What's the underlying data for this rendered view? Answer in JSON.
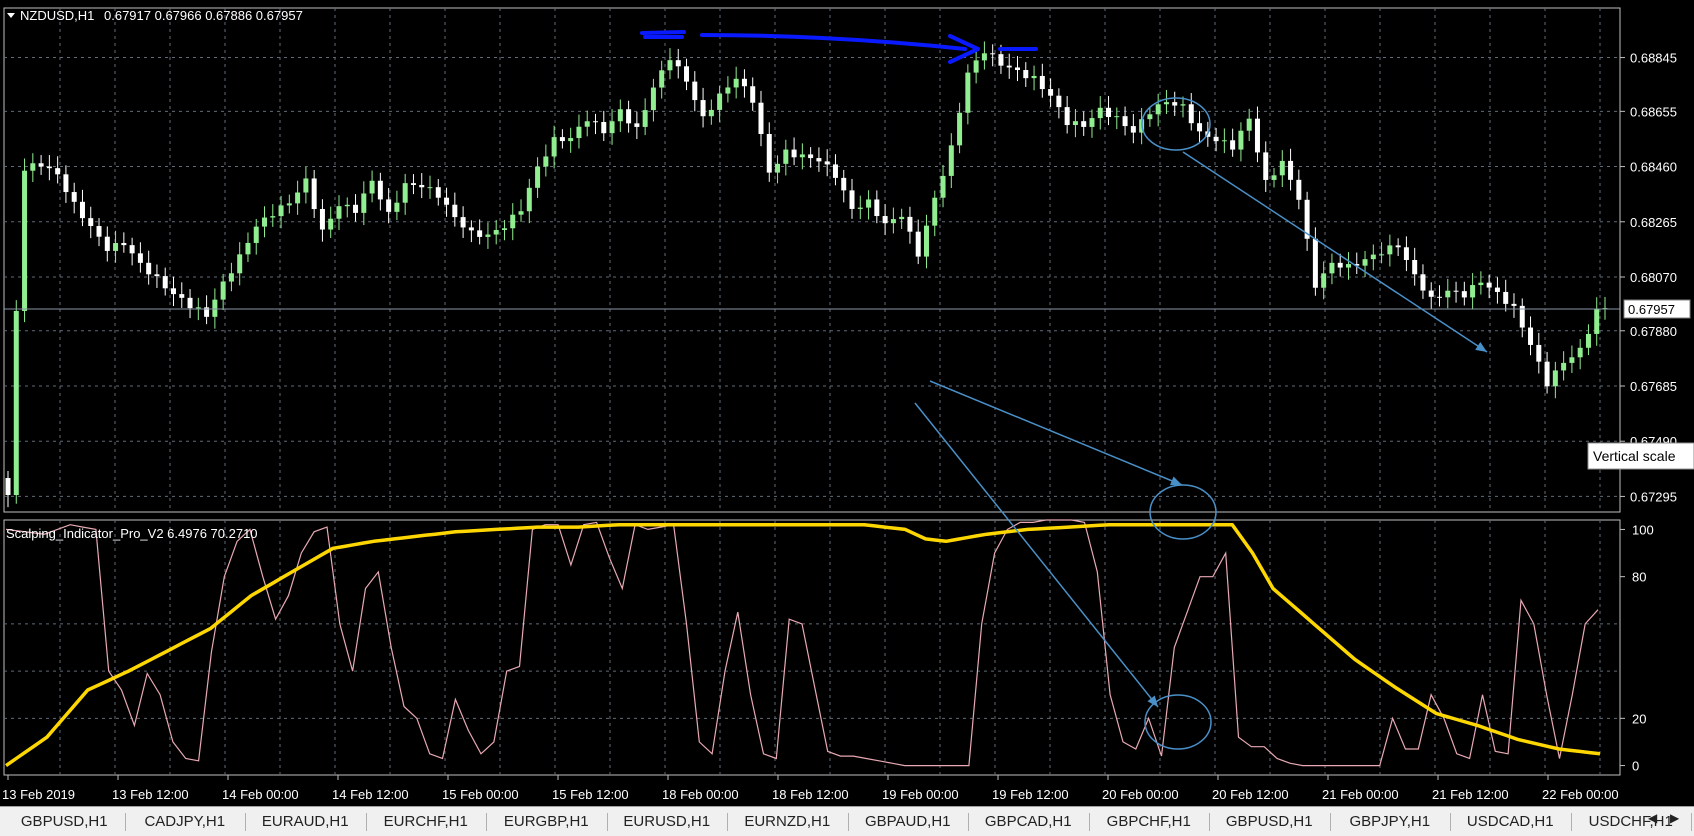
{
  "chart_data": {
    "type": "candlestick",
    "symbol_header": "NZDUSD,H1",
    "ohlc_header": "0.67917 0.67966 0.67886 0.67957",
    "current_price_label": "0.67957",
    "current_price": 0.67957,
    "price_ylim": [
      0.6724,
      0.6902
    ],
    "price_ticks": [
      "0.68845",
      "0.68655",
      "0.68460",
      "0.68265",
      "0.68070",
      "0.67880",
      "0.67685",
      "0.67490",
      "0.67295"
    ],
    "price_tick_values": [
      0.68845,
      0.68655,
      0.6846,
      0.68265,
      0.6807,
      0.6788,
      0.67685,
      0.6749,
      0.67295
    ],
    "x_ticks": [
      "13 Feb 2019",
      "13 Feb 12:00",
      "14 Feb 00:00",
      "14 Feb 12:00",
      "15 Feb 00:00",
      "15 Feb 12:00",
      "18 Feb 00:00",
      "18 Feb 12:00",
      "19 Feb 00:00",
      "19 Feb 12:00",
      "20 Feb 00:00",
      "20 Feb 12:00",
      "21 Feb 00:00",
      "21 Feb 12:00",
      "22 Feb 00:00"
    ],
    "indicator_header": "Scalping_Indicator_Pro_V2 6.4976 70.2710",
    "indicator_ylim": [
      -4,
      104
    ],
    "indicator_ticks": [
      "100",
      "80",
      "20",
      "0"
    ],
    "indicator_tick_values": [
      100,
      80,
      20,
      0
    ],
    "close_anchors": [
      [
        0,
        0.673
      ],
      [
        1,
        0.6795
      ],
      [
        2,
        0.6845
      ],
      [
        4,
        0.6846
      ],
      [
        6,
        0.6842
      ],
      [
        8,
        0.6832
      ],
      [
        10,
        0.6825
      ],
      [
        12,
        0.6818
      ],
      [
        14,
        0.682
      ],
      [
        16,
        0.6812
      ],
      [
        18,
        0.6806
      ],
      [
        20,
        0.68
      ],
      [
        22,
        0.6796
      ],
      [
        24,
        0.6793
      ],
      [
        26,
        0.6805
      ],
      [
        28,
        0.6815
      ],
      [
        30,
        0.6826
      ],
      [
        32,
        0.683
      ],
      [
        34,
        0.6833
      ],
      [
        36,
        0.684
      ],
      [
        38,
        0.6822
      ],
      [
        40,
        0.6832
      ],
      [
        42,
        0.6831
      ],
      [
        44,
        0.6842
      ],
      [
        46,
        0.683
      ],
      [
        48,
        0.684
      ],
      [
        50,
        0.6839
      ],
      [
        52,
        0.6835
      ],
      [
        54,
        0.6827
      ],
      [
        56,
        0.6822
      ],
      [
        58,
        0.6822
      ],
      [
        60,
        0.6826
      ],
      [
        62,
        0.6832
      ],
      [
        64,
        0.6846
      ],
      [
        66,
        0.6855
      ],
      [
        68,
        0.6855
      ],
      [
        70,
        0.6862
      ],
      [
        72,
        0.6858
      ],
      [
        74,
        0.6866
      ],
      [
        76,
        0.686
      ],
      [
        78,
        0.6875
      ],
      [
        80,
        0.6885
      ],
      [
        82,
        0.6876
      ],
      [
        84,
        0.6862
      ],
      [
        86,
        0.687
      ],
      [
        88,
        0.6877
      ],
      [
        90,
        0.687
      ],
      [
        92,
        0.6845
      ],
      [
        94,
        0.6852
      ],
      [
        96,
        0.685
      ],
      [
        98,
        0.6848
      ],
      [
        100,
        0.6842
      ],
      [
        102,
        0.683
      ],
      [
        104,
        0.6833
      ],
      [
        106,
        0.6826
      ],
      [
        108,
        0.683
      ],
      [
        110,
        0.6816
      ],
      [
        112,
        0.6835
      ],
      [
        114,
        0.6852
      ],
      [
        116,
        0.6878
      ],
      [
        118,
        0.6886
      ],
      [
        120,
        0.6882
      ],
      [
        122,
        0.688
      ],
      [
        124,
        0.6878
      ],
      [
        126,
        0.6872
      ],
      [
        128,
        0.6862
      ],
      [
        130,
        0.686
      ],
      [
        132,
        0.6865
      ],
      [
        134,
        0.6862
      ],
      [
        136,
        0.6858
      ],
      [
        138,
        0.6866
      ],
      [
        140,
        0.687
      ],
      [
        142,
        0.6868
      ],
      [
        144,
        0.6858
      ],
      [
        146,
        0.6855
      ],
      [
        148,
        0.6852
      ],
      [
        150,
        0.6862
      ],
      [
        152,
        0.684
      ],
      [
        154,
        0.6848
      ],
      [
        156,
        0.6836
      ],
      [
        158,
        0.6805
      ],
      [
        160,
        0.6812
      ],
      [
        162,
        0.681
      ],
      [
        164,
        0.6812
      ],
      [
        166,
        0.6815
      ],
      [
        168,
        0.6818
      ],
      [
        170,
        0.6808
      ],
      [
        172,
        0.68
      ],
      [
        174,
        0.6803
      ],
      [
        176,
        0.6801
      ],
      [
        178,
        0.6805
      ],
      [
        180,
        0.68
      ],
      [
        182,
        0.6795
      ],
      [
        184,
        0.6783
      ],
      [
        186,
        0.677
      ],
      [
        188,
        0.6778
      ],
      [
        190,
        0.6782
      ],
      [
        192,
        0.6795
      ],
      [
        193,
        0.6796
      ]
    ],
    "oscillator_anchors": [
      [
        0,
        100
      ],
      [
        3,
        98
      ],
      [
        5,
        102
      ],
      [
        7,
        100
      ],
      [
        8,
        40
      ],
      [
        9,
        32
      ],
      [
        10,
        17
      ],
      [
        11,
        39
      ],
      [
        12,
        30
      ],
      [
        13,
        10
      ],
      [
        14,
        3
      ],
      [
        15,
        2
      ],
      [
        16,
        48
      ],
      [
        17,
        80
      ],
      [
        18,
        95
      ],
      [
        19,
        100
      ],
      [
        20,
        80
      ],
      [
        21,
        62
      ],
      [
        22,
        72
      ],
      [
        23,
        90
      ],
      [
        24,
        99
      ],
      [
        25,
        101
      ],
      [
        26,
        60
      ],
      [
        27,
        40
      ],
      [
        28,
        75
      ],
      [
        29,
        82
      ],
      [
        30,
        50
      ],
      [
        31,
        25
      ],
      [
        32,
        20
      ],
      [
        33,
        5
      ],
      [
        34,
        3
      ],
      [
        35,
        28
      ],
      [
        36,
        15
      ],
      [
        37,
        5
      ],
      [
        38,
        10
      ],
      [
        39,
        40
      ],
      [
        40,
        42
      ],
      [
        41,
        100
      ],
      [
        42,
        102
      ],
      [
        43,
        102
      ],
      [
        44,
        85
      ],
      [
        45,
        102
      ],
      [
        46,
        103
      ],
      [
        47,
        88
      ],
      [
        48,
        75
      ],
      [
        49,
        102
      ],
      [
        50,
        100
      ],
      [
        51,
        101
      ],
      [
        52,
        102
      ],
      [
        53,
        60
      ],
      [
        54,
        10
      ],
      [
        55,
        5
      ],
      [
        56,
        40
      ],
      [
        57,
        65
      ],
      [
        58,
        30
      ],
      [
        59,
        5
      ],
      [
        60,
        3
      ],
      [
        61,
        62
      ],
      [
        62,
        60
      ],
      [
        63,
        33
      ],
      [
        64,
        6
      ],
      [
        65,
        4
      ],
      [
        66,
        4
      ],
      [
        67,
        3
      ],
      [
        68,
        2
      ],
      [
        69,
        1
      ],
      [
        70,
        0
      ],
      [
        71,
        0
      ],
      [
        72,
        0
      ],
      [
        73,
        0
      ],
      [
        74,
        0
      ],
      [
        75,
        0
      ],
      [
        76,
        60
      ],
      [
        77,
        90
      ],
      [
        78,
        100
      ],
      [
        79,
        103
      ],
      [
        80,
        103
      ],
      [
        81,
        104
      ],
      [
        82,
        104
      ],
      [
        83,
        104
      ],
      [
        84,
        103
      ],
      [
        85,
        82
      ],
      [
        86,
        30
      ],
      [
        87,
        10
      ],
      [
        88,
        7
      ],
      [
        89,
        20
      ],
      [
        90,
        4
      ],
      [
        91,
        50
      ],
      [
        92,
        65
      ],
      [
        93,
        80
      ],
      [
        94,
        80
      ],
      [
        95,
        90
      ],
      [
        96,
        12
      ],
      [
        97,
        8
      ],
      [
        98,
        8
      ],
      [
        99,
        3
      ],
      [
        100,
        1
      ],
      [
        101,
        0
      ],
      [
        102,
        0
      ],
      [
        103,
        0
      ],
      [
        104,
        0
      ],
      [
        105,
        0
      ],
      [
        106,
        0
      ],
      [
        107,
        0
      ],
      [
        108,
        20
      ],
      [
        109,
        7
      ],
      [
        110,
        7
      ],
      [
        111,
        30
      ],
      [
        112,
        20
      ],
      [
        113,
        5
      ],
      [
        114,
        3
      ],
      [
        115,
        30
      ],
      [
        116,
        6
      ],
      [
        117,
        5
      ],
      [
        118,
        70
      ],
      [
        119,
        60
      ],
      [
        120,
        30
      ],
      [
        121,
        3
      ],
      [
        122,
        30
      ],
      [
        123,
        60
      ],
      [
        124,
        66
      ]
    ],
    "slow_line_anchors": [
      [
        0,
        0
      ],
      [
        4,
        12
      ],
      [
        8,
        32
      ],
      [
        12,
        40
      ],
      [
        16,
        49
      ],
      [
        20,
        58
      ],
      [
        24,
        72
      ],
      [
        28,
        82
      ],
      [
        32,
        92
      ],
      [
        36,
        95
      ],
      [
        40,
        97
      ],
      [
        44,
        99
      ],
      [
        48,
        100
      ],
      [
        52,
        101
      ],
      [
        56,
        101
      ],
      [
        60,
        102
      ],
      [
        64,
        102
      ],
      [
        68,
        102
      ],
      [
        72,
        102
      ],
      [
        76,
        102
      ],
      [
        80,
        102
      ],
      [
        84,
        102
      ],
      [
        88,
        100
      ],
      [
        90,
        96
      ],
      [
        92,
        95
      ],
      [
        96,
        98
      ],
      [
        100,
        100
      ],
      [
        104,
        101
      ],
      [
        108,
        102
      ],
      [
        112,
        102
      ],
      [
        116,
        102
      ],
      [
        118,
        102
      ],
      [
        120,
        102
      ],
      [
        122,
        90
      ],
      [
        124,
        75
      ],
      [
        128,
        60
      ],
      [
        132,
        45
      ],
      [
        136,
        33
      ],
      [
        140,
        22
      ],
      [
        144,
        17
      ],
      [
        148,
        11
      ],
      [
        152,
        7
      ],
      [
        156,
        5
      ]
    ],
    "series": [
      {
        "name": "NZDUSD,H1"
      },
      {
        "name": "Scalping_Indicator_Pro_V2"
      }
    ],
    "annotations": {
      "floating_label": "Vertical scale"
    }
  },
  "tabs": [
    "GBPUSD,H1",
    "CADJPY,H1",
    "EURAUD,H1",
    "EURCHF,H1",
    "EURGBP,H1",
    "EURUSD,H1",
    "EURNZD,H1",
    "GBPAUD,H1",
    "GBPCAD,H1",
    "GBPCHF,H1",
    "GBPUSD,H1",
    "GBPJPY,H1",
    "USDCAD,H1",
    "USDCHF,H1"
  ],
  "colors": {
    "background": "#000000",
    "grid": "#5f6b78",
    "bull": "#90ee90",
    "bear": "#ffffff",
    "slow_line": "#ffd700",
    "oscillator": "#e8a9b4",
    "annotation_arrow": "#4a90c8",
    "drawn_marker": "#0a1aff"
  }
}
